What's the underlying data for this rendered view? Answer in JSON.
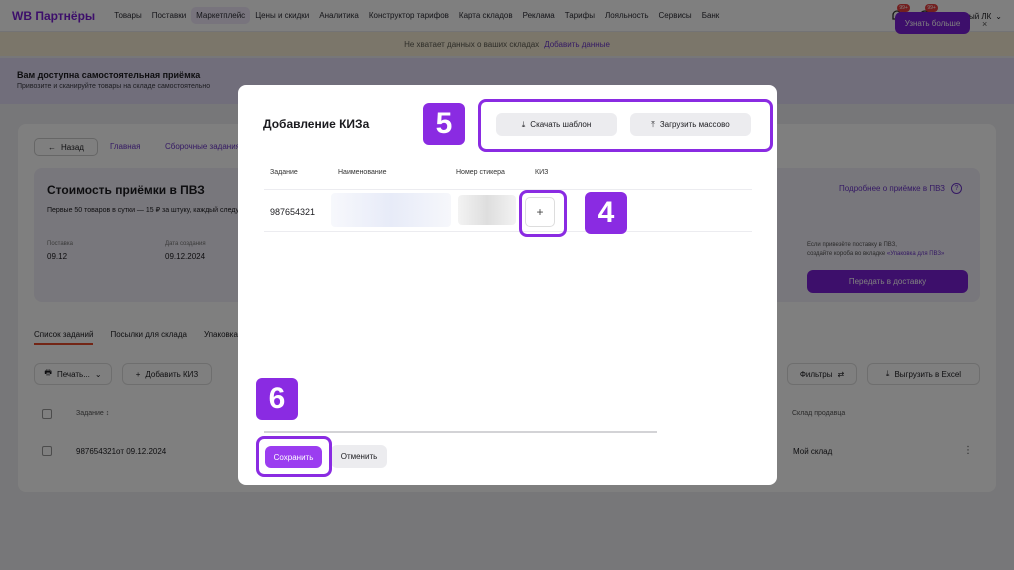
{
  "topnav": {
    "logo": "WB Партнёры",
    "items": [
      "Товары",
      "Поставки",
      "Маркетплейс",
      "Цены и скидки",
      "Аналитика",
      "Конструктор тарифов",
      "Карта складов",
      "Реклама",
      "Тарифы",
      "Лояльность",
      "Сервисы",
      "Банк"
    ],
    "active_item": "Маркетплейс",
    "notif_badge_1": "99+",
    "notif_badge_2": "99+",
    "account": "Учебный ЛК",
    "account_chevron": "⌄"
  },
  "warning": {
    "text": "Не хватает данных о ваших складах",
    "link": "Добавить данные"
  },
  "promo": {
    "title": "Вам доступна самостоятельная приёмка",
    "text": "Привозите и сканируйте товары на складе самостоятельно",
    "button": "Узнать больше",
    "close": "×"
  },
  "background": {
    "back_button": "Назад",
    "back_arrow": "←",
    "breadcrumb_1": "Главная",
    "breadcrumb_2": "Сборочные задания",
    "pvz_title": "Стоимость приёмки в ПВЗ",
    "pvz_subtitle": "Первые 50 товаров в сутки — 15 ₽ за штуку, каждый следующий",
    "pvz_link": "Подробнее о приёмке в ПВЗ",
    "pvz_link_icon": "?",
    "field_1_label": "Поставка",
    "field_1_value": "09.12",
    "field_2_label": "Дата создания",
    "field_2_value": "09.12.2024",
    "info_line1": "Если привезёте поставку в ПВЗ,",
    "info_line2_prefix": "создайте короба во вкладке ",
    "info_line2_link": "«Упаковка для ПВЗ»",
    "deliver_button": "Передать в доставку",
    "tabs": [
      "Список заданий",
      "Посылки для склада",
      "Упаковка"
    ],
    "print_button": "Печать...",
    "print_icon": "🖶",
    "print_chevron": "⌄",
    "add_kiz_button": "Добавить КИЗ",
    "add_icon": "+",
    "filters_button": "Фильтры",
    "filters_icon": "⇄",
    "export_button": "Выгрузить в Excel",
    "export_icon": "⤓",
    "col_task": "Задание",
    "col_sort_icon": "↕",
    "col_warehouse": "Склад продавца",
    "row_task": "987654321от 09.12.2024",
    "row_warehouse": "Мой склад",
    "row_menu": "⋮"
  },
  "modal": {
    "title": "Добавление КИЗа",
    "download_template": "Скачать шаблон",
    "download_icon": "⤓",
    "bulk_upload": "Загрузить массово",
    "upload_icon": "⤒",
    "columns": {
      "task": "Задание",
      "name": "Наименование",
      "sticker": "Номер стикера",
      "kiz": "КИЗ"
    },
    "row": {
      "task": "987654321",
      "kiz_add": "+"
    },
    "save": "Сохранить",
    "cancel": "Отменить"
  },
  "callouts": {
    "four": "4",
    "five": "5",
    "six": "6",
    "color": "#8a2be2"
  },
  "colors": {
    "brand": "#7a1fd6",
    "overlay": "rgba(0,0,0,0.5)",
    "warning_bg": "#f6ecd4",
    "promo_bg": "#e2dcf6"
  }
}
